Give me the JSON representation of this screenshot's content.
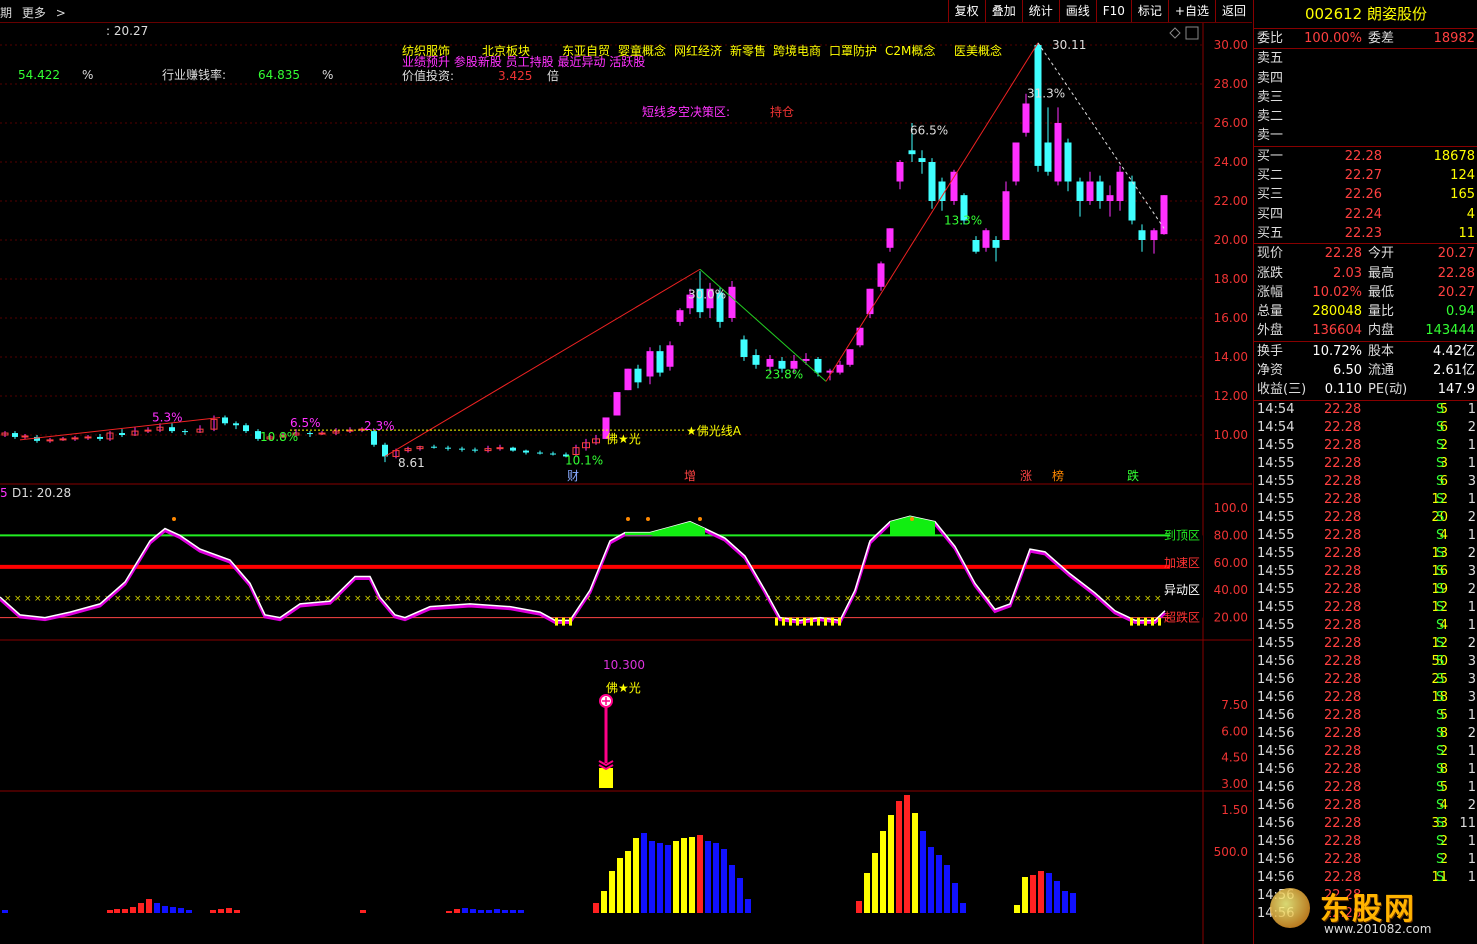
{
  "toolbar": {
    "left_label": "期",
    "more_label": "更多",
    "buttons": [
      "复权",
      "叠加",
      "统计",
      "画线",
      "F10",
      "标记",
      "+自选",
      "返回"
    ]
  },
  "info": {
    "top_value": ": 20.27",
    "left_pct": "54.422",
    "left_unit": "%",
    "industry_label": "行业赚钱率:",
    "industry_value": "64.835",
    "industry_unit": "%",
    "concepts_row1": [
      "纺织服饰",
      "北京板块",
      "东亚自贸",
      "婴童概念",
      "网红经济",
      "新零售",
      "跨境电商",
      "口罩防护",
      "C2M概念",
      "医美概念"
    ],
    "concepts_row2": "业绩预升  参股新股  员工持股  最近异动  活跃股",
    "value_label": "价值投资:",
    "value_num": "3.425",
    "value_unit": "倍",
    "decision_label": "短线多空决策区:",
    "decision_value": "持仓"
  },
  "main_chart": {
    "y_ticks": [
      "30.00",
      "28.00",
      "26.00",
      "24.00",
      "22.00",
      "20.00",
      "18.00",
      "16.00",
      "14.00",
      "12.00",
      "10.00"
    ],
    "annotations": [
      "5.3%",
      "6.5%",
      "2.3%",
      "10.8%",
      "8.61",
      "10.1%",
      "30.0%",
      "23.8%",
      "66.5%",
      "13.3%",
      "31.3%",
      "30.11"
    ],
    "markers": [
      "财",
      "增",
      "涨",
      "榜",
      "跌"
    ],
    "foguang_line": "★佛光线A",
    "foguang": "佛★光"
  },
  "osc_chart": {
    "title_prefix": "5",
    "title": "D1: 20.28",
    "y_ticks": [
      "100.0",
      "80.00",
      "60.00",
      "40.00",
      "20.00"
    ],
    "zone_labels": [
      "到顶区",
      "加速区",
      "异动区",
      "超跌区"
    ]
  },
  "signal_chart": {
    "value": "10.300",
    "label": "佛★光",
    "y_ticks": [
      "7.50",
      "6.00",
      "4.50",
      "3.00",
      "1.50"
    ]
  },
  "volume_chart": {
    "y_tick": "500.0"
  },
  "quote": {
    "code": "002612",
    "name": "朗姿股份",
    "weibi_label": "委比",
    "weibi_value": "100.00%",
    "weicha_label": "委差",
    "weicha_value": "18982",
    "sells": [
      {
        "label": "卖五",
        "price": "",
        "vol": ""
      },
      {
        "label": "卖四",
        "price": "",
        "vol": ""
      },
      {
        "label": "卖三",
        "price": "",
        "vol": ""
      },
      {
        "label": "卖二",
        "price": "",
        "vol": ""
      },
      {
        "label": "卖一",
        "price": "",
        "vol": ""
      }
    ],
    "buys": [
      {
        "label": "买一",
        "price": "22.28",
        "vol": "18678"
      },
      {
        "label": "买二",
        "price": "22.27",
        "vol": "124"
      },
      {
        "label": "买三",
        "price": "22.26",
        "vol": "165"
      },
      {
        "label": "买四",
        "price": "22.24",
        "vol": "4"
      },
      {
        "label": "买五",
        "price": "22.23",
        "vol": "11"
      }
    ],
    "stats": [
      {
        "l1": "现价",
        "v1": "22.28",
        "l2": "今开",
        "v2": "20.27"
      },
      {
        "l1": "涨跌",
        "v1": "2.03",
        "l2": "最高",
        "v2": "22.28"
      },
      {
        "l1": "涨幅",
        "v1": "10.02%",
        "l2": "最低",
        "v2": "20.27"
      },
      {
        "l1": "总量",
        "v1": "280048",
        "l2": "量比",
        "v2": "0.94"
      },
      {
        "l1": "外盘",
        "v1": "136604",
        "l2": "内盘",
        "v2": "143444"
      }
    ],
    "stats2": [
      {
        "l1": "换手",
        "v1": "10.72%",
        "l2": "股本",
        "v2": "4.42亿"
      },
      {
        "l1": "净资",
        "v1": "6.50",
        "l2": "流通",
        "v2": "2.61亿"
      },
      {
        "l1": "收益(三)",
        "v1": "0.110",
        "l2": "PE(动)",
        "v2": "147.9"
      }
    ]
  },
  "ticks": [
    {
      "t": "14:54",
      "p": "22.28",
      "v": "5",
      "bs": "S",
      "n": "1"
    },
    {
      "t": "14:54",
      "p": "22.28",
      "v": "6",
      "bs": "S",
      "n": "2"
    },
    {
      "t": "14:55",
      "p": "22.28",
      "v": "2",
      "bs": "S",
      "n": "1"
    },
    {
      "t": "14:55",
      "p": "22.28",
      "v": "3",
      "bs": "S",
      "n": "1"
    },
    {
      "t": "14:55",
      "p": "22.28",
      "v": "6",
      "bs": "S",
      "n": "3"
    },
    {
      "t": "14:55",
      "p": "22.28",
      "v": "12",
      "bs": "S",
      "n": "1"
    },
    {
      "t": "14:55",
      "p": "22.28",
      "v": "20",
      "bs": "S",
      "n": "2"
    },
    {
      "t": "14:55",
      "p": "22.28",
      "v": "4",
      "bs": "S",
      "n": "1"
    },
    {
      "t": "14:55",
      "p": "22.28",
      "v": "13",
      "bs": "S",
      "n": "2"
    },
    {
      "t": "14:55",
      "p": "22.28",
      "v": "16",
      "bs": "S",
      "n": "3"
    },
    {
      "t": "14:55",
      "p": "22.28",
      "v": "19",
      "bs": "S",
      "n": "2"
    },
    {
      "t": "14:55",
      "p": "22.28",
      "v": "12",
      "bs": "S",
      "n": "1"
    },
    {
      "t": "14:55",
      "p": "22.28",
      "v": "4",
      "bs": "S",
      "n": "1"
    },
    {
      "t": "14:55",
      "p": "22.28",
      "v": "12",
      "bs": "S",
      "n": "2"
    },
    {
      "t": "14:56",
      "p": "22.28",
      "v": "50",
      "bs": "S",
      "n": "3"
    },
    {
      "t": "14:56",
      "p": "22.28",
      "v": "25",
      "bs": "S",
      "n": "3"
    },
    {
      "t": "14:56",
      "p": "22.28",
      "v": "18",
      "bs": "S",
      "n": "3"
    },
    {
      "t": "14:56",
      "p": "22.28",
      "v": "5",
      "bs": "S",
      "n": "1"
    },
    {
      "t": "14:56",
      "p": "22.28",
      "v": "8",
      "bs": "S",
      "n": "2"
    },
    {
      "t": "14:56",
      "p": "22.28",
      "v": "2",
      "bs": "S",
      "n": "1"
    },
    {
      "t": "14:56",
      "p": "22.28",
      "v": "8",
      "bs": "S",
      "n": "1"
    },
    {
      "t": "14:56",
      "p": "22.28",
      "v": "5",
      "bs": "S",
      "n": "1"
    },
    {
      "t": "14:56",
      "p": "22.28",
      "v": "4",
      "bs": "S",
      "n": "2"
    },
    {
      "t": "14:56",
      "p": "22.28",
      "v": "33",
      "bs": "S",
      "n": "11"
    },
    {
      "t": "14:56",
      "p": "22.28",
      "v": "2",
      "bs": "S",
      "n": "1"
    },
    {
      "t": "14:56",
      "p": "22.28",
      "v": "2",
      "bs": "S",
      "n": "1"
    },
    {
      "t": "14:56",
      "p": "22.28",
      "v": "11",
      "bs": "S",
      "n": "1"
    },
    {
      "t": "14:56",
      "p": "22.28",
      "v": "",
      "bs": "",
      "n": ""
    },
    {
      "t": "14:56",
      "p": "22.28",
      "v": "",
      "bs": "",
      "n": ""
    }
  ],
  "watermark": {
    "title": "东股网",
    "url": "www.201082.com"
  },
  "colors": {
    "up": "#ff30ff",
    "down": "#40ffff",
    "red": "#ff2020",
    "yellow": "#ffff00",
    "green": "#22dd22",
    "blue": "#0000ee",
    "grid": "#500"
  }
}
